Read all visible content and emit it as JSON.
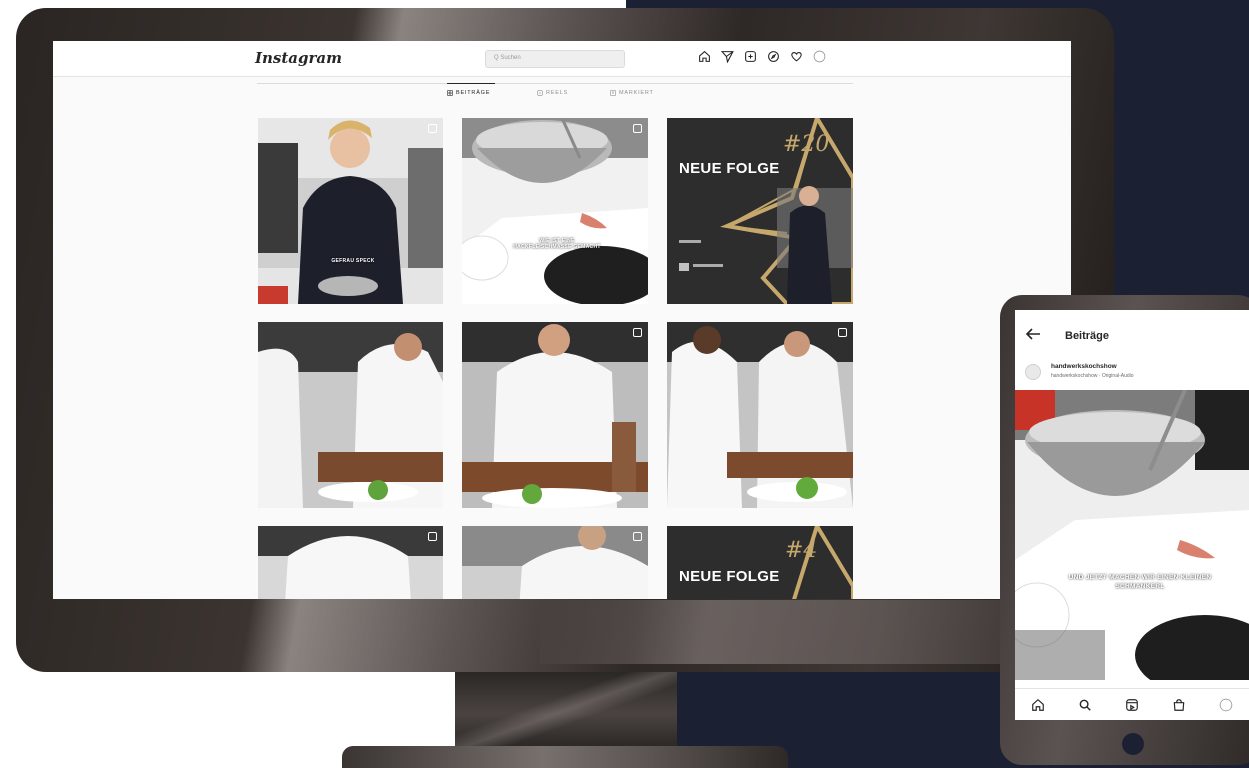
{
  "desktop": {
    "app_logo": "Instagram",
    "search": {
      "placeholder": "Q Suchen"
    },
    "nav_icons": [
      "home-icon",
      "direct-icon",
      "new-post-icon",
      "explore-icon",
      "heart-icon",
      "profile-icon"
    ],
    "tabs": [
      {
        "label": "BEITRÄGE",
        "active": true
      },
      {
        "label": "REELS",
        "active": false
      },
      {
        "label": "MARKIERT",
        "active": false
      }
    ],
    "posts": [
      {
        "caption": "GEFRAU SPECK"
      },
      {
        "caption": "WIE IST EINE HACKFLEISCHMASSE GEMACHT"
      },
      {
        "title": "NEUE FOLGE",
        "number": "#20"
      },
      {
        "caption": ""
      },
      {
        "caption": ""
      },
      {
        "caption": ""
      },
      {
        "caption": ""
      },
      {
        "caption": ""
      },
      {
        "title": "NEUE FOLGE",
        "number": "#4"
      }
    ]
  },
  "mobile": {
    "header_title": "Beiträge",
    "username": "handwerkskochshow",
    "audio_line": "handwerkskochshow · Original-Audio",
    "caption": "UND JETZT MACHEN WIR EINEN KLEINEN SCHMANKERL",
    "nav_icons": [
      "home-icon",
      "search-icon",
      "reels-icon",
      "shop-icon",
      "profile-icon"
    ]
  },
  "colors": {
    "navy_background": "#1b2133",
    "monitor_bezel": "#2e2826",
    "instagram_text": "#262626"
  }
}
